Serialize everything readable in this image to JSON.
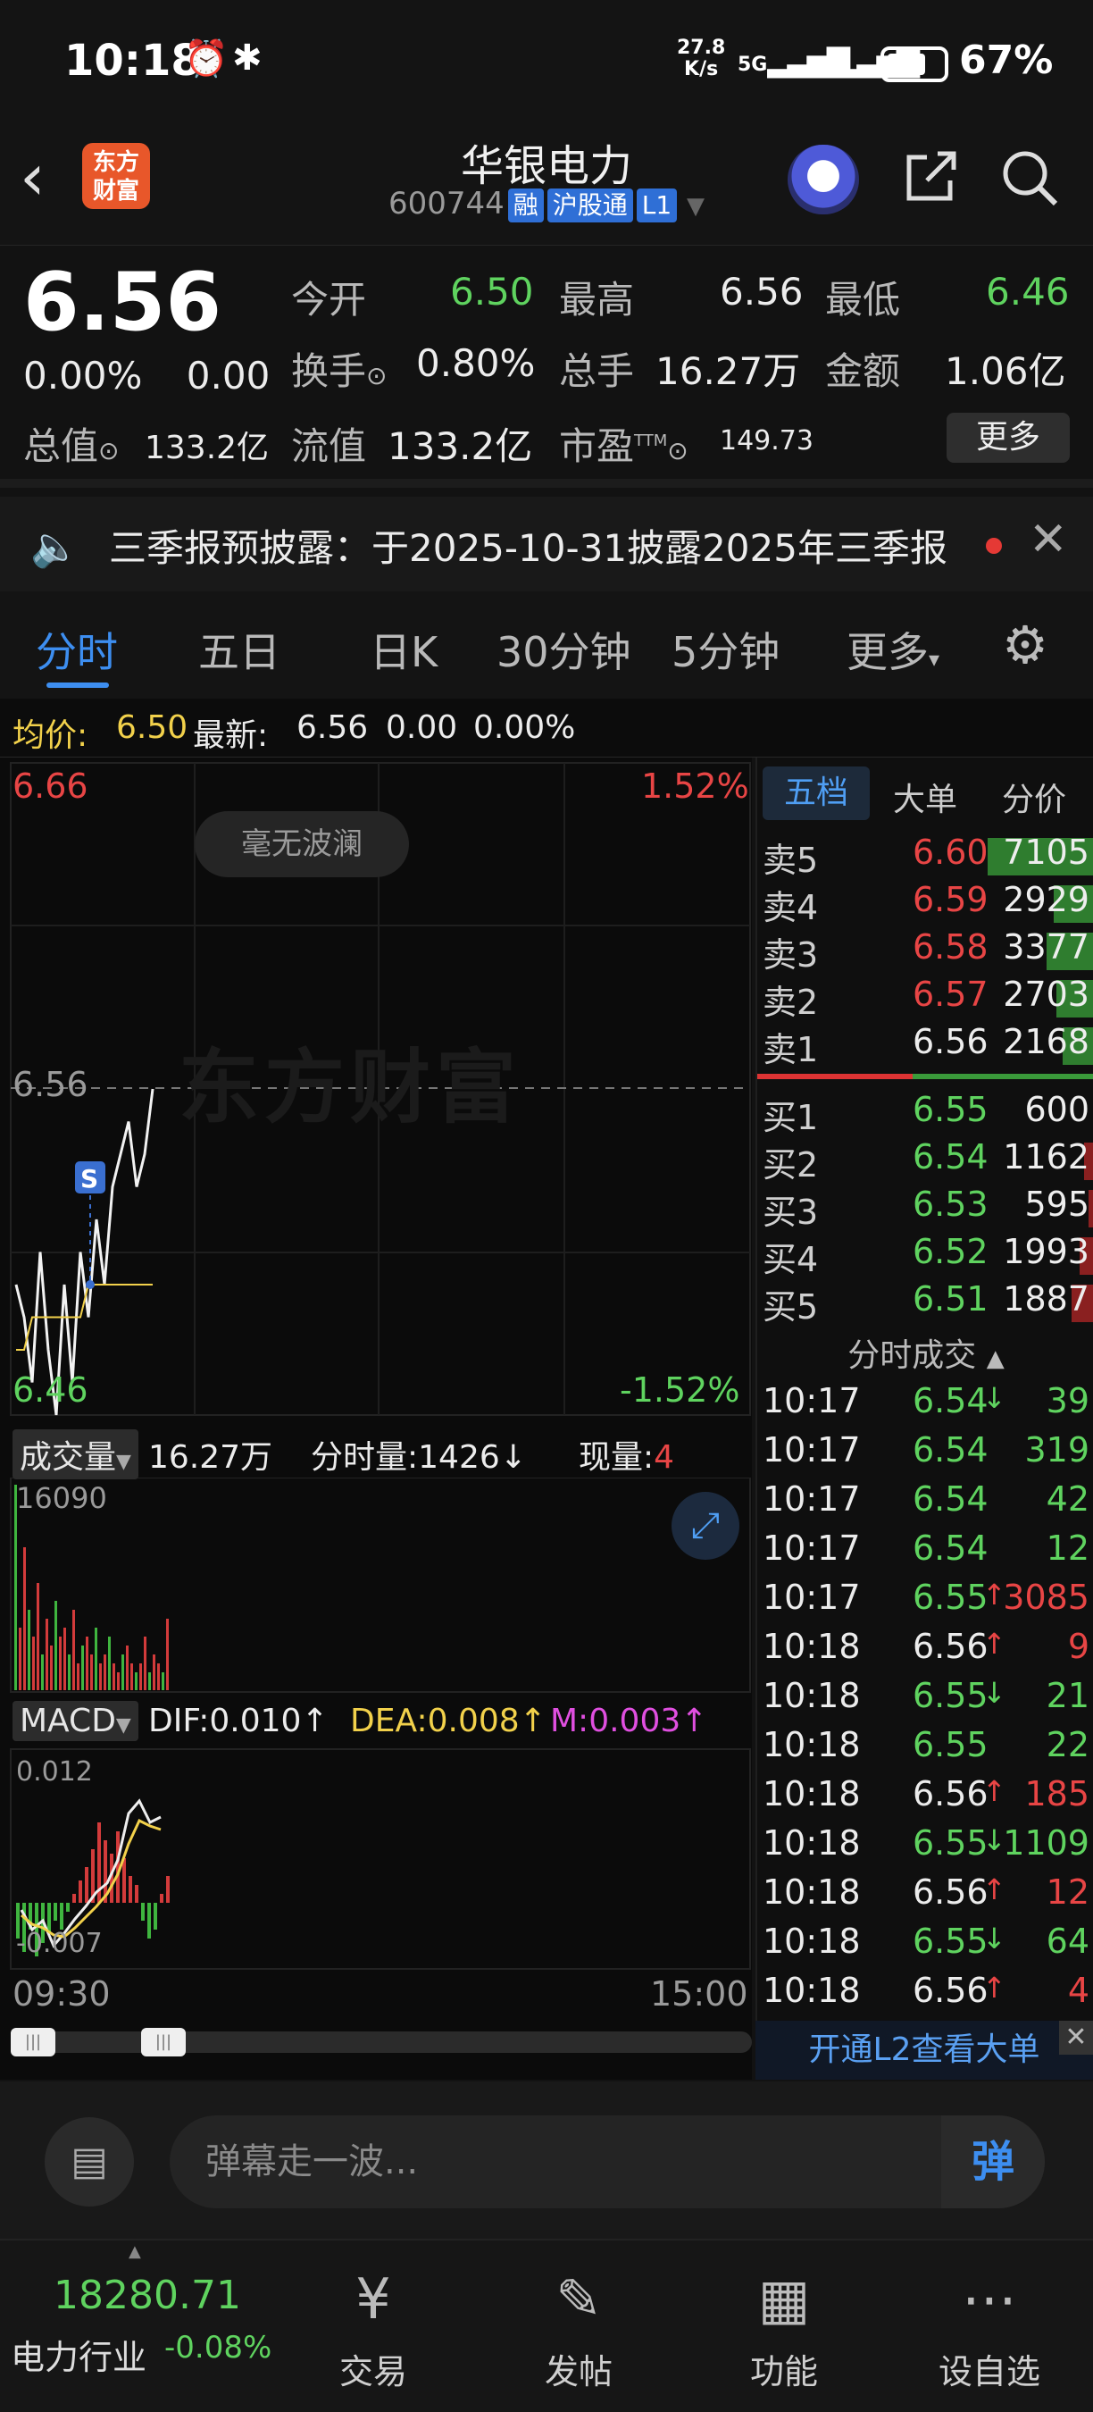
{
  "status_bar": {
    "time": "10:18",
    "net_speed_value": "27.8",
    "net_speed_unit": "K/s",
    "signal1": "5G",
    "signal2": "5G",
    "battery": "67%"
  },
  "header": {
    "logo_line1": "东方",
    "logo_line2": "财富",
    "stock_name": "华银电力",
    "stock_code": "600744",
    "tags": [
      "融",
      "沪股通",
      "L1"
    ]
  },
  "quote": {
    "price": "6.56",
    "change_pct": "0.00%",
    "change_amt": "0.00",
    "open_label": "今开",
    "open_value": "6.50",
    "high_label": "最高",
    "high_value": "6.56",
    "low_label": "最低",
    "low_value": "6.46",
    "turnover_label": "换手",
    "turnover_value": "0.80%",
    "volume_label": "总手",
    "volume_value": "16.27万",
    "amount_label": "金额",
    "amount_value": "1.06亿",
    "mktcap_label": "总值",
    "mktcap_value": "133.2亿",
    "float_label": "流值",
    "float_value": "133.2亿",
    "pe_label": "市盈",
    "pe_sup": "TTM",
    "pe_value": "149.73",
    "more_label": "更多"
  },
  "notice": {
    "text": "三季报预披露：于2025-10-31披露2025年三季报"
  },
  "tabs": [
    "分时",
    "五日",
    "日K",
    "30分钟",
    "5分钟",
    "更多"
  ],
  "avg_row": {
    "avg_label": "均价:",
    "avg_value": "6.50",
    "latest_label": "最新:",
    "latest_value": "6.56",
    "latest_chg": "0.00",
    "latest_pct": "0.00%"
  },
  "chart": {
    "top_price": "6.66",
    "top_pct": "1.52%",
    "bottom_price": "6.46",
    "bottom_pct": "-1.52%",
    "mid_price": "6.56",
    "badge": "毫无波澜",
    "watermark": "东方财富",
    "s_marker": "S",
    "vol_label": "成交量",
    "vol_total": "16.27万",
    "fenshi_label": "分时量:",
    "fenshi_value": "1426",
    "xianliang_label": "现量:",
    "xianliang_value": "4",
    "vol_max": "16090",
    "macd_label": "MACD",
    "dif": "DIF:0.010",
    "dea": "DEA:0.008",
    "m": "M:0.003",
    "macd_top": "0.012",
    "macd_bottom": "-0.007",
    "time_start": "09:30",
    "time_end": "15:00"
  },
  "chart_data": {
    "type": "line",
    "title": "",
    "series": [
      {
        "name": "",
        "values": [
          6.5,
          6.49,
          6.47,
          6.51,
          6.48,
          6.46,
          6.5,
          6.47,
          6.51,
          6.49,
          6.52,
          6.5,
          6.53,
          6.54,
          6.55,
          6.53,
          6.54,
          6.56
        ]
      },
      {
        "name": "",
        "values": [
          6.48,
          6.48,
          6.49,
          6.49,
          6.49,
          6.49,
          6.49,
          6.49,
          6.49,
          6.5,
          6.5,
          6.5,
          6.5,
          6.5,
          6.5,
          6.5,
          6.5,
          6.5
        ]
      }
    ],
    "ylim": [
      6.46,
      6.66
    ],
    "xlabel": "",
    "ylabel": ""
  },
  "right_panel": {
    "tabs": [
      "五档",
      "大单",
      "分价"
    ],
    "asks": [
      {
        "label": "卖5",
        "price": "6.60",
        "vol": "7105",
        "bar": 1.0
      },
      {
        "label": "卖4",
        "price": "6.59",
        "vol": "2929",
        "bar": 0.38
      },
      {
        "label": "卖3",
        "price": "6.58",
        "vol": "3377",
        "bar": 0.45
      },
      {
        "label": "卖2",
        "price": "6.57",
        "vol": "2703",
        "bar": 0.36
      },
      {
        "label": "卖1",
        "price": "6.56",
        "vol": "2168",
        "bar": 0.3
      }
    ],
    "bids": [
      {
        "label": "买1",
        "price": "6.55",
        "vol": "600",
        "bar": 0.0
      },
      {
        "label": "买2",
        "price": "6.54",
        "vol": "1162",
        "bar": 0.1
      },
      {
        "label": "买3",
        "price": "6.53",
        "vol": "595",
        "bar": 0.06
      },
      {
        "label": "买4",
        "price": "6.52",
        "vol": "1993",
        "bar": 0.14
      },
      {
        "label": "买5",
        "price": "6.51",
        "vol": "1887",
        "bar": 0.22
      }
    ],
    "trades_title": "分时成交",
    "trades": [
      {
        "time": "10:17",
        "price": "6.54",
        "dir": "↓",
        "vol": "39",
        "c": "green"
      },
      {
        "time": "10:17",
        "price": "6.54",
        "dir": "",
        "vol": "319",
        "c": "green"
      },
      {
        "time": "10:17",
        "price": "6.54",
        "dir": "",
        "vol": "42",
        "c": "green"
      },
      {
        "time": "10:17",
        "price": "6.54",
        "dir": "",
        "vol": "12",
        "c": "green"
      },
      {
        "time": "10:17",
        "price": "6.55",
        "dir": "↑",
        "vol": "3085",
        "c": "red"
      },
      {
        "time": "10:18",
        "price": "6.56",
        "dir": "↑",
        "vol": "9",
        "c": "red"
      },
      {
        "time": "10:18",
        "price": "6.55",
        "dir": "↓",
        "vol": "21",
        "c": "green"
      },
      {
        "time": "10:18",
        "price": "6.55",
        "dir": "",
        "vol": "22",
        "c": "green"
      },
      {
        "time": "10:18",
        "price": "6.56",
        "dir": "↑",
        "vol": "185",
        "c": "red"
      },
      {
        "time": "10:18",
        "price": "6.55",
        "dir": "↓",
        "vol": "1109",
        "c": "green"
      },
      {
        "time": "10:18",
        "price": "6.56",
        "dir": "↑",
        "vol": "12",
        "c": "red"
      },
      {
        "time": "10:18",
        "price": "6.55",
        "dir": "↓",
        "vol": "64",
        "c": "green"
      },
      {
        "time": "10:18",
        "price": "6.56",
        "dir": "↑",
        "vol": "4",
        "c": "red"
      }
    ],
    "l2_banner": "开通L2查看大单"
  },
  "comment": {
    "placeholder": "弹幕走一波...",
    "danmu_button": "弹"
  },
  "bottom_nav": {
    "index_value": "18280.71",
    "index_name": "电力行业",
    "index_change": "-0.08%",
    "items": [
      "交易",
      "发帖",
      "功能",
      "设自选"
    ]
  }
}
